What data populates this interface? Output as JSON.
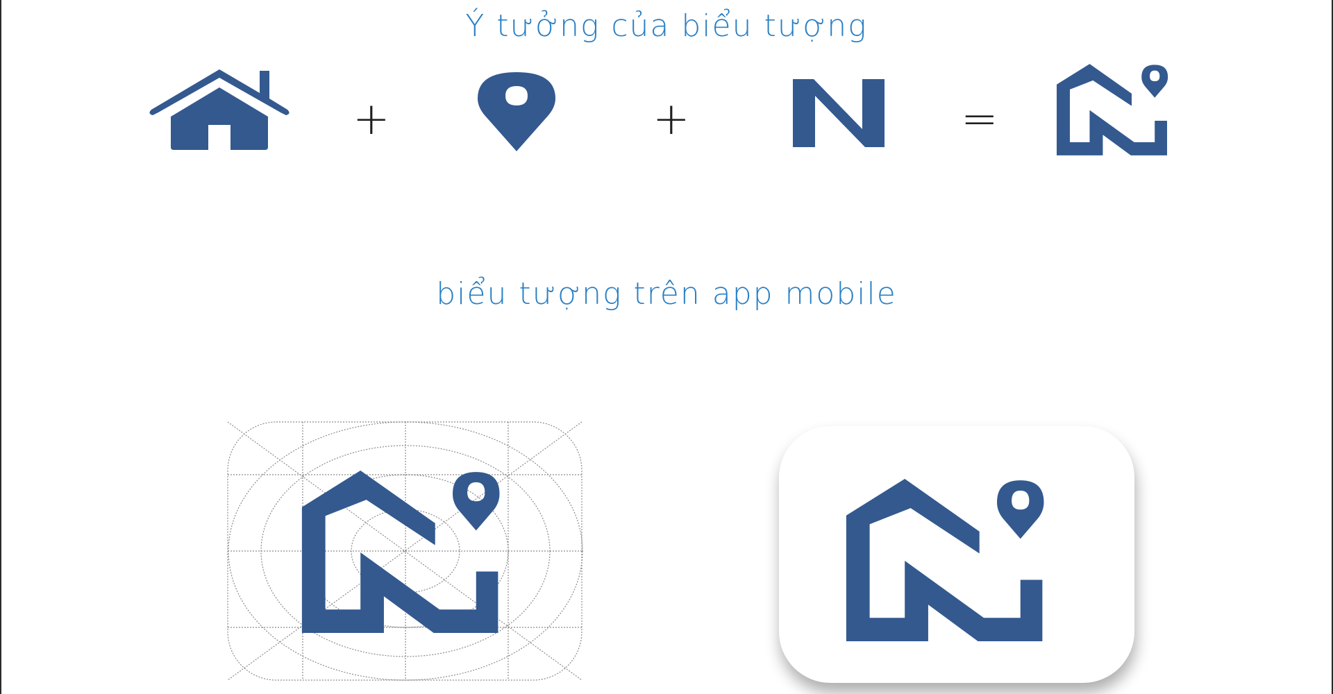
{
  "headings": {
    "idea_title": "Ý tưởng của biểu tượng",
    "app_title": "biểu tượng trên app mobile"
  },
  "equation": {
    "plus_1": "+",
    "plus_2": "+",
    "equals": "="
  },
  "icons": {
    "parts": [
      "house-icon",
      "location-pin-icon",
      "letter-n-icon"
    ],
    "result": "combined-n-house-pin-logo",
    "app_versions": [
      "logo-construction-grid",
      "app-icon-final"
    ]
  },
  "logo_letter": "N",
  "colors": {
    "brand_blue": "#33598f",
    "heading_blue": "#2a7fc4",
    "grid_gray": "#8a8a8a",
    "operator": "#1f1f1f"
  }
}
